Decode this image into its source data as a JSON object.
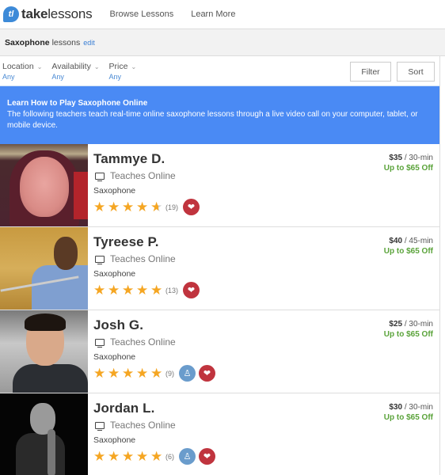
{
  "header": {
    "logo_text_bold": "take",
    "logo_text_light": "lessons",
    "logo_mark": "tl",
    "nav": [
      "Browse Lessons",
      "Learn More"
    ]
  },
  "search": {
    "subject": "Saxophone",
    "suffix": "lessons",
    "edit_label": "edit"
  },
  "filters": [
    {
      "label": "Location",
      "value": "Any"
    },
    {
      "label": "Availability",
      "value": "Any"
    },
    {
      "label": "Price",
      "value": "Any"
    }
  ],
  "actions": {
    "filter_label": "Filter",
    "sort_label": "Sort"
  },
  "banner": {
    "title": "Learn How to Play Saxophone Online",
    "text": "The following teachers teach real-time online saxophone lessons through a live video call on your computer, tablet, or mobile device.",
    "color": "#4a8af4"
  },
  "teachers": [
    {
      "name": "Tammye D.",
      "mode": "Teaches Online",
      "subject": "Saxophone",
      "rating": 4.5,
      "reviews": "(19)",
      "price": "$35",
      "duration": "/ 30-min",
      "discount": "Up to $65 Off",
      "badge": false
    },
    {
      "name": "Tyreese P.",
      "mode": "Teaches Online",
      "subject": "Saxophone",
      "rating": 5,
      "reviews": "(13)",
      "price": "$40",
      "duration": "/ 45-min",
      "discount": "Up to $65 Off",
      "badge": false
    },
    {
      "name": "Josh G.",
      "mode": "Teaches Online",
      "subject": "Saxophone",
      "rating": 5,
      "reviews": "(9)",
      "price": "$25",
      "duration": "/ 30-min",
      "discount": "Up to $65 Off",
      "badge": true
    },
    {
      "name": "Jordan L.",
      "mode": "Teaches Online",
      "subject": "Saxophone",
      "rating": 5,
      "reviews": "(6)",
      "price": "$30",
      "duration": "/ 30-min",
      "discount": "Up to $65 Off",
      "badge": true
    }
  ],
  "icons": {
    "monitor": "monitor-icon",
    "heart": "heart-icon",
    "badge": "teacher-badge-icon",
    "star": "star-icon",
    "chevron": "chevron-down-icon"
  },
  "colors": {
    "accent": "#4a8af4",
    "discount": "#5aa33a",
    "heart": "#c0343e",
    "badge": "#6a9ccc",
    "star": "#f5a623",
    "link": "#4a8ad4"
  }
}
